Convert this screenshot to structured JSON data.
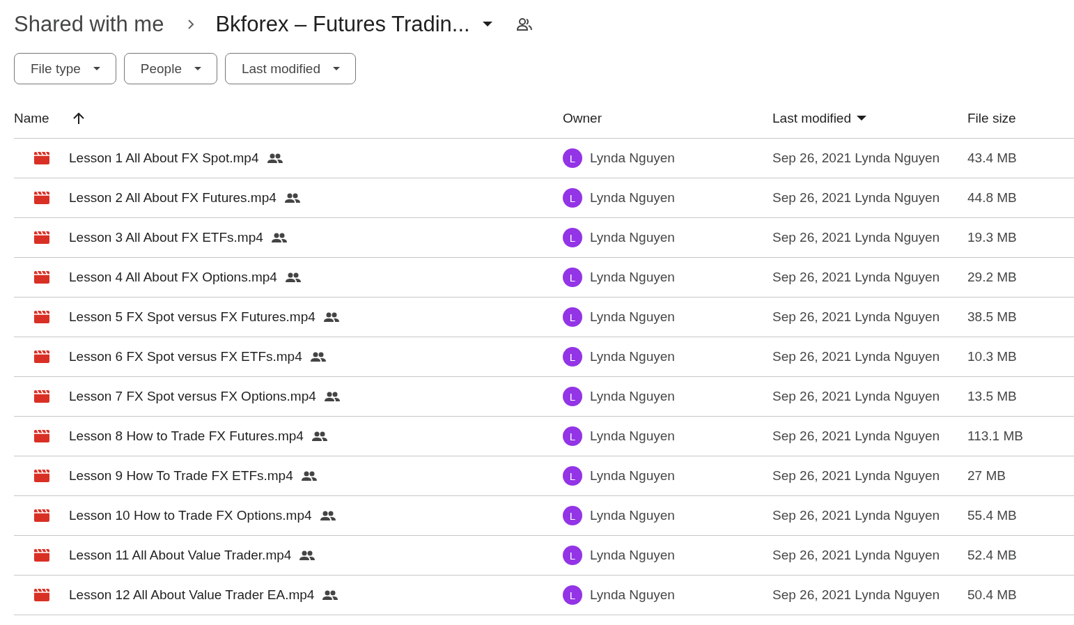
{
  "breadcrumb": {
    "parent": "Shared with me",
    "current": "Bkforex – Futures Tradin..."
  },
  "filters": [
    {
      "label": "File type"
    },
    {
      "label": "People"
    },
    {
      "label": "Last modified"
    }
  ],
  "table": {
    "columns": [
      "Name",
      "Owner",
      "Last modified",
      "File size"
    ],
    "rows": [
      {
        "name": "Lesson 1 All About FX Spot.mp4",
        "avatar": "L",
        "owner": "Lynda Nguyen",
        "modified": "Sep 26, 2021 Lynda Nguyen",
        "size": "43.4 MB"
      },
      {
        "name": "Lesson 2 All About FX Futures.mp4",
        "avatar": "L",
        "owner": "Lynda Nguyen",
        "modified": "Sep 26, 2021 Lynda Nguyen",
        "size": "44.8 MB"
      },
      {
        "name": "Lesson 3 All About FX ETFs.mp4",
        "avatar": "L",
        "owner": "Lynda Nguyen",
        "modified": "Sep 26, 2021 Lynda Nguyen",
        "size": "19.3 MB"
      },
      {
        "name": "Lesson 4 All About FX Options.mp4",
        "avatar": "L",
        "owner": "Lynda Nguyen",
        "modified": "Sep 26, 2021 Lynda Nguyen",
        "size": "29.2 MB"
      },
      {
        "name": "Lesson 5 FX Spot versus FX Futures.mp4",
        "avatar": "L",
        "owner": "Lynda Nguyen",
        "modified": "Sep 26, 2021 Lynda Nguyen",
        "size": "38.5 MB"
      },
      {
        "name": "Lesson 6 FX Spot versus FX ETFs.mp4",
        "avatar": "L",
        "owner": "Lynda Nguyen",
        "modified": "Sep 26, 2021 Lynda Nguyen",
        "size": "10.3 MB"
      },
      {
        "name": "Lesson 7 FX Spot versus FX Options.mp4",
        "avatar": "L",
        "owner": "Lynda Nguyen",
        "modified": "Sep 26, 2021 Lynda Nguyen",
        "size": "13.5 MB"
      },
      {
        "name": "Lesson 8 How to Trade FX Futures.mp4",
        "avatar": "L",
        "owner": "Lynda Nguyen",
        "modified": "Sep 26, 2021 Lynda Nguyen",
        "size": "113.1 MB"
      },
      {
        "name": "Lesson 9 How To Trade FX ETFs.mp4",
        "avatar": "L",
        "owner": "Lynda Nguyen",
        "modified": "Sep 26, 2021 Lynda Nguyen",
        "size": "27 MB"
      },
      {
        "name": "Lesson 10 How to Trade FX Options.mp4",
        "avatar": "L",
        "owner": "Lynda Nguyen",
        "modified": "Sep 26, 2021 Lynda Nguyen",
        "size": "55.4 MB"
      },
      {
        "name": "Lesson 11 All About Value Trader.mp4",
        "avatar": "L",
        "owner": "Lynda Nguyen",
        "modified": "Sep 26, 2021 Lynda Nguyen",
        "size": "52.4 MB"
      },
      {
        "name": "Lesson 12 All About Value Trader EA.mp4",
        "avatar": "L",
        "owner": "Lynda Nguyen",
        "modified": "Sep 26, 2021 Lynda Nguyen",
        "size": "50.4 MB"
      }
    ]
  }
}
